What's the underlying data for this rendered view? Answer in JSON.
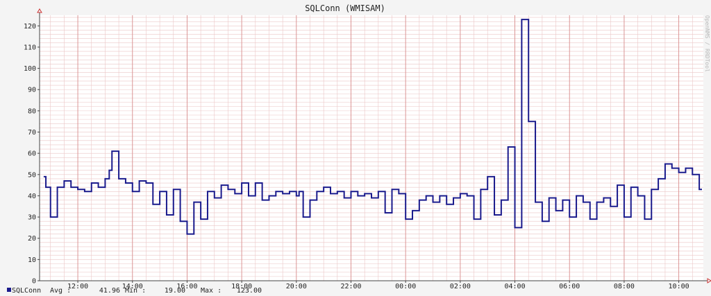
{
  "chart_data": {
    "type": "line",
    "title": "SQLConn (WMISAM)",
    "side_label": "OpenNMS / RRDTool",
    "ylim": [
      0,
      125
    ],
    "y_ticks": [
      0,
      10,
      20,
      30,
      40,
      50,
      60,
      70,
      80,
      90,
      100,
      110,
      120
    ],
    "x_ticks": [
      "12:00",
      "14:00",
      "16:00",
      "18:00",
      "20:00",
      "22:00",
      "00:00",
      "02:00",
      "04:00",
      "06:00",
      "08:00",
      "10:00"
    ],
    "series": [
      {
        "name": "SQLConn",
        "color": "#1a1a8c",
        "x_hours": [
          10.75,
          10.83,
          11.0,
          11.25,
          11.5,
          11.75,
          12.0,
          12.25,
          12.5,
          12.75,
          13.0,
          13.15,
          13.25,
          13.5,
          13.75,
          14.0,
          14.25,
          14.5,
          14.75,
          15.0,
          15.25,
          15.5,
          15.75,
          16.0,
          16.25,
          16.5,
          16.75,
          17.0,
          17.25,
          17.5,
          17.75,
          18.0,
          18.25,
          18.5,
          18.75,
          19.0,
          19.25,
          19.5,
          19.75,
          20.0,
          20.1,
          20.25,
          20.5,
          20.75,
          21.0,
          21.25,
          21.5,
          21.75,
          22.0,
          22.25,
          22.5,
          22.75,
          23.0,
          23.25,
          23.5,
          23.75,
          24.0,
          24.25,
          24.5,
          24.75,
          25.0,
          25.25,
          25.5,
          25.75,
          26.0,
          26.25,
          26.5,
          26.75,
          27.0,
          27.25,
          27.5,
          27.75,
          28.0,
          28.25,
          28.5,
          28.75,
          29.0,
          29.25,
          29.5,
          29.75,
          30.0,
          30.25,
          30.5,
          30.75,
          31.0,
          31.25,
          31.5,
          31.75,
          32.0,
          32.25,
          32.5,
          32.75,
          33.0,
          33.25,
          33.5,
          33.75,
          34.0,
          34.25,
          34.5,
          34.75
        ],
        "values": [
          49,
          44,
          30,
          44,
          47,
          44,
          43,
          42,
          46,
          44,
          48,
          52,
          61,
          48,
          46,
          42,
          47,
          46,
          36,
          42,
          31,
          43,
          28,
          22,
          37,
          29,
          42,
          39,
          45,
          43,
          41,
          46,
          40,
          46,
          38,
          40,
          42,
          41,
          42,
          40,
          42,
          30,
          38,
          42,
          44,
          41,
          42,
          39,
          42,
          40,
          41,
          39,
          42,
          32,
          43,
          41,
          29,
          33,
          38,
          40,
          37,
          40,
          36,
          39,
          41,
          40,
          29,
          43,
          49,
          31,
          38,
          63,
          25,
          123,
          75,
          37,
          28,
          39,
          33,
          38,
          30,
          40,
          37,
          29,
          37,
          39,
          35,
          45,
          30,
          44,
          40,
          29,
          43,
          48,
          55,
          53,
          51,
          53,
          50,
          43,
          51,
          51
        ]
      }
    ],
    "legend": {
      "series_label": "SQLConn",
      "avg_label": "Avg :",
      "avg": "41.96",
      "min_label": "Min :",
      "min": "19.00",
      "max_label": "Max :",
      "max": "123.00"
    },
    "colors": {
      "background": "#f4f4f4",
      "plot_background": "#ffffff",
      "grid_minor": "#ebc6c6",
      "grid_major": "#d98f8f",
      "line": "#1a1a8c"
    }
  }
}
